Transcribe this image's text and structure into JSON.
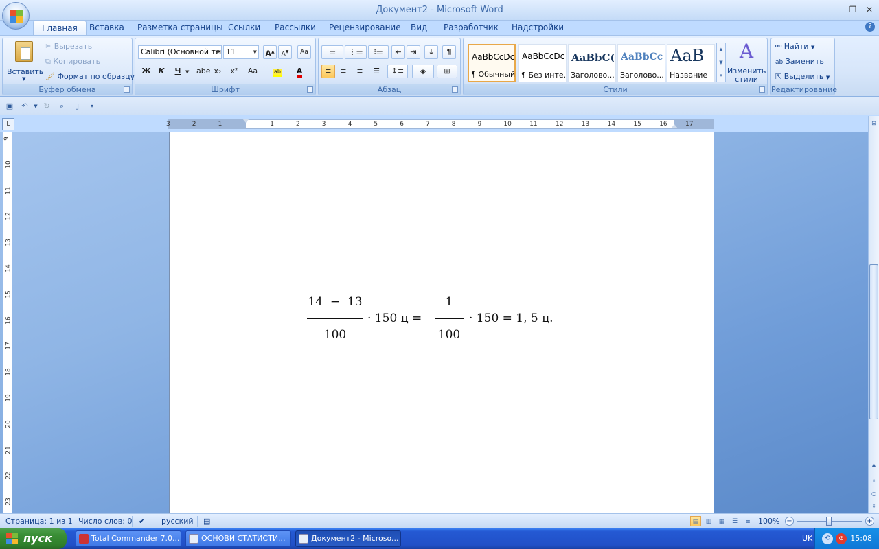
{
  "window": {
    "title": "Документ2 - Microsoft Word",
    "controls": {
      "minimize": "‒",
      "restore": "❐",
      "close": "✕"
    }
  },
  "tabs": [
    "Главная",
    "Вставка",
    "Разметка страницы",
    "Ссылки",
    "Рассылки",
    "Рецензирование",
    "Вид",
    "Разработчик",
    "Надстройки"
  ],
  "active_tab": "Главная",
  "help": "?",
  "ribbon": {
    "clipboard": {
      "label": "Буфер обмена",
      "paste": "Вставить",
      "cut": "Вырезать",
      "copy": "Копировать",
      "format_painter": "Формат по образцу"
    },
    "font": {
      "label": "Шрифт",
      "font_name": "Calibri (Основной текст)",
      "font_size": "11",
      "bold": "Ж",
      "italic": "К",
      "underline": "Ч",
      "strike": "abe",
      "subscript": "x₂",
      "superscript": "x²",
      "change_case": "Aa",
      "grow": "A",
      "shrink": "A"
    },
    "paragraph": {
      "label": "Абзац",
      "pilcrow": "¶"
    },
    "styles": {
      "label": "Стили",
      "items": [
        {
          "sample": "AaBbCcDc",
          "name": "¶ Обычный"
        },
        {
          "sample": "AaBbCcDc",
          "name": "¶ Без инте..."
        },
        {
          "sample": "AaBbC(",
          "name": "Заголово..."
        },
        {
          "sample": "AaBbCc",
          "name": "Заголово..."
        },
        {
          "sample": "AaB",
          "name": "Название"
        }
      ],
      "change_styles": "Изменить стили"
    },
    "editing": {
      "label": "Редактирование",
      "find": "Найти",
      "replace": "Заменить",
      "select": "Выделить"
    }
  },
  "ruler": {
    "h_ticks": [
      "3",
      "2",
      "1",
      "1",
      "2",
      "3",
      "4",
      "5",
      "6",
      "7",
      "8",
      "9",
      "10",
      "11",
      "12",
      "13",
      "14",
      "15",
      "16",
      "17"
    ],
    "v_ticks": [
      "9",
      "10",
      "11",
      "12",
      "13",
      "14",
      "15",
      "16",
      "17",
      "18",
      "19",
      "20",
      "21",
      "22",
      "23"
    ]
  },
  "equation": {
    "frac1_num": "14  −  13",
    "frac1_den": "100",
    "part1": "· 150  ц  =",
    "frac2_num": "1",
    "frac2_den": "100",
    "part2": "· 150  = 1, 5 ц."
  },
  "statusbar": {
    "page": "Страница: 1 из 1",
    "words": "Число слов: 0",
    "language": "русский",
    "zoom": "100%",
    "zoom_level": 1.0
  },
  "taskbar": {
    "start": "пуск",
    "tasks": [
      {
        "label": "Total Commander 7.0...",
        "active": false
      },
      {
        "label": "ОСНОВИ СТАТИСТИ...",
        "active": false
      },
      {
        "label": "Документ2 - Microso...",
        "active": true
      }
    ],
    "lang": "UK",
    "clock": "15:08"
  },
  "colors": {
    "ribbon_text": "#15428b",
    "canvas_blue": "#6f9cd8",
    "taskbar_blue": "#2150c8",
    "start_green": "#3a8f36"
  }
}
